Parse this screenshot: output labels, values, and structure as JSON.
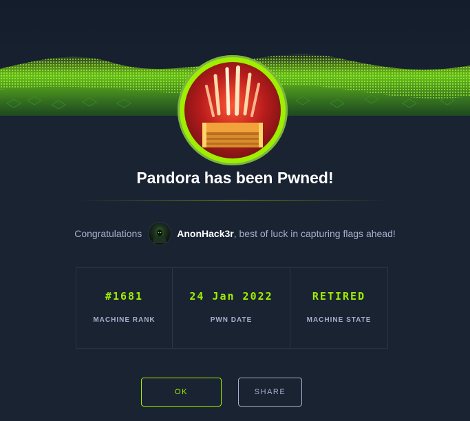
{
  "title": "Pandora has been Pwned!",
  "congrats": {
    "prefix": "Congratulations",
    "username": "AnonHack3r",
    "suffix": ", best of luck in capturing flags ahead!"
  },
  "stats": [
    {
      "value": "#1681",
      "label": "MACHINE RANK"
    },
    {
      "value": "24 Jan 2022",
      "label": "PWN DATE"
    },
    {
      "value": "RETIRED",
      "label": "MACHINE STATE"
    }
  ],
  "buttons": {
    "ok_label": "OK",
    "share_label": "SHARE"
  },
  "colors": {
    "accent": "#9fef00",
    "background": "#1a2332",
    "muted_text": "#a4b1cd"
  },
  "icons": {
    "badge": "pandora-box-badge-icon",
    "avatar": "hooded-hacker-avatar"
  }
}
